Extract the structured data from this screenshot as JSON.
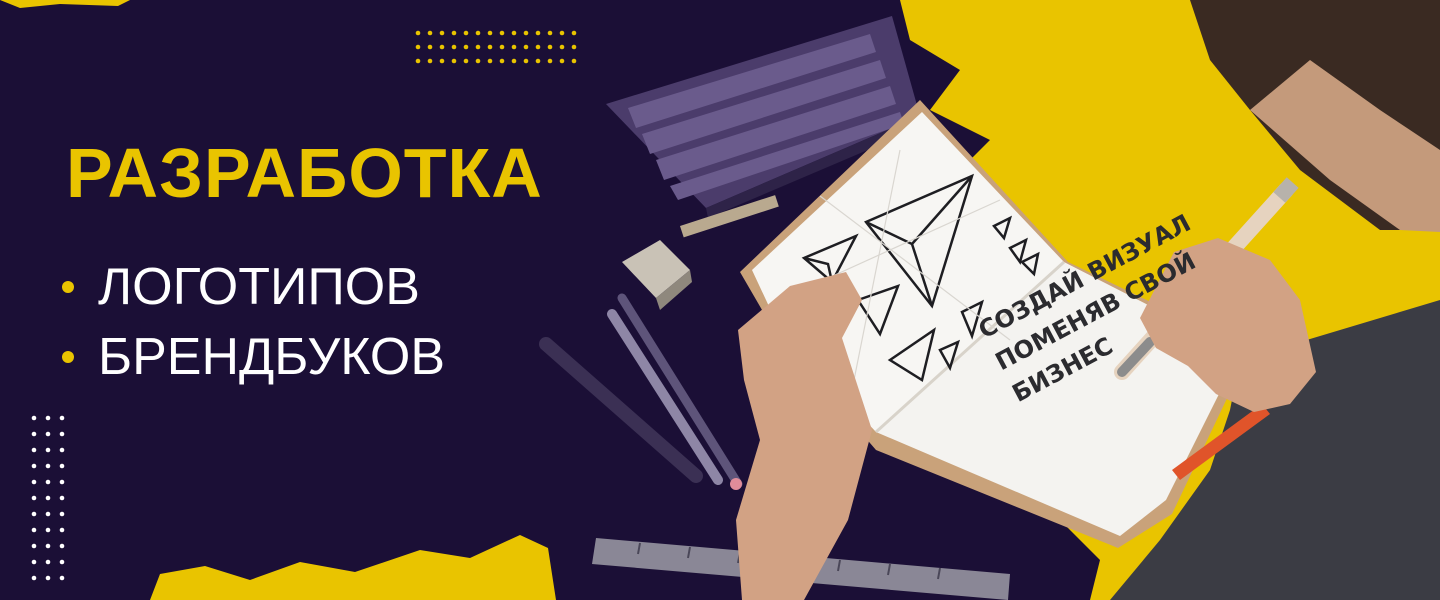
{
  "headline": "РАЗРАБОТКА",
  "bullets": [
    {
      "label": "ЛОГОТИПОВ"
    },
    {
      "label": "БРЕНДБУКОВ"
    }
  ],
  "notebook": {
    "handwriting_lines": [
      "СОЗДАЙ ВИЗУАЛ",
      "ПОМЕНЯВ СВОЙ",
      "БИЗНЕС"
    ]
  },
  "colors": {
    "background": "#1b0f36",
    "accent_yellow": "#e9c400",
    "text_white": "#ffffff"
  }
}
